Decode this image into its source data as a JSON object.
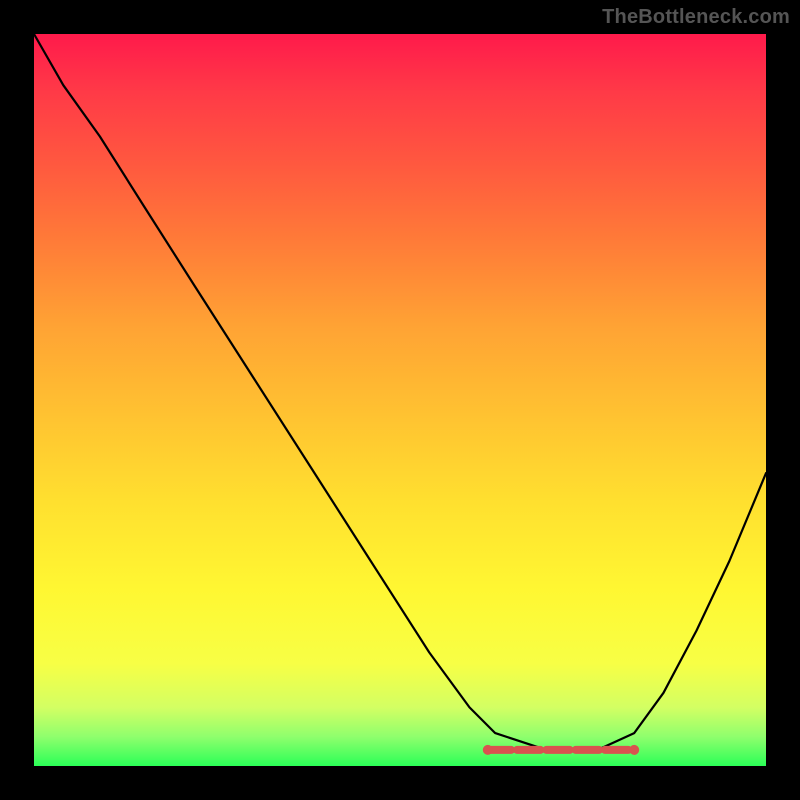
{
  "watermark": "TheBottleneck.com",
  "colors": {
    "background": "#000000",
    "curve": "#000000",
    "marker": "#d9534f",
    "gradient_top": "#ff1a4b",
    "gradient_bottom": "#2bff57"
  },
  "chart_data": {
    "type": "line",
    "title": "",
    "xlabel": "",
    "ylabel": "",
    "xlim": [
      0,
      1
    ],
    "ylim": [
      0,
      1
    ],
    "note": "Axes ungraduated; values are normalized 0–1 fractions of plot width/height. y is measured from top (0) to bottom (1). The black curve descends from upper-left to a flat minimum near x≈0.63–0.82 then rises toward the right edge. Red capsule markers sit on the flat valley region.",
    "series": [
      {
        "name": "curve",
        "x": [
          0.0,
          0.04,
          0.09,
          0.15,
          0.22,
          0.3,
          0.38,
          0.46,
          0.54,
          0.595,
          0.63,
          0.7,
          0.77,
          0.82,
          0.86,
          0.905,
          0.95,
          1.0
        ],
        "y": [
          0.0,
          0.07,
          0.14,
          0.235,
          0.345,
          0.47,
          0.595,
          0.72,
          0.845,
          0.92,
          0.955,
          0.978,
          0.978,
          0.955,
          0.9,
          0.815,
          0.72,
          0.6
        ]
      }
    ],
    "valley_markers_x": [
      0.62,
      0.66,
      0.7,
      0.74,
      0.78,
      0.82
    ],
    "valley_y": 0.978
  }
}
